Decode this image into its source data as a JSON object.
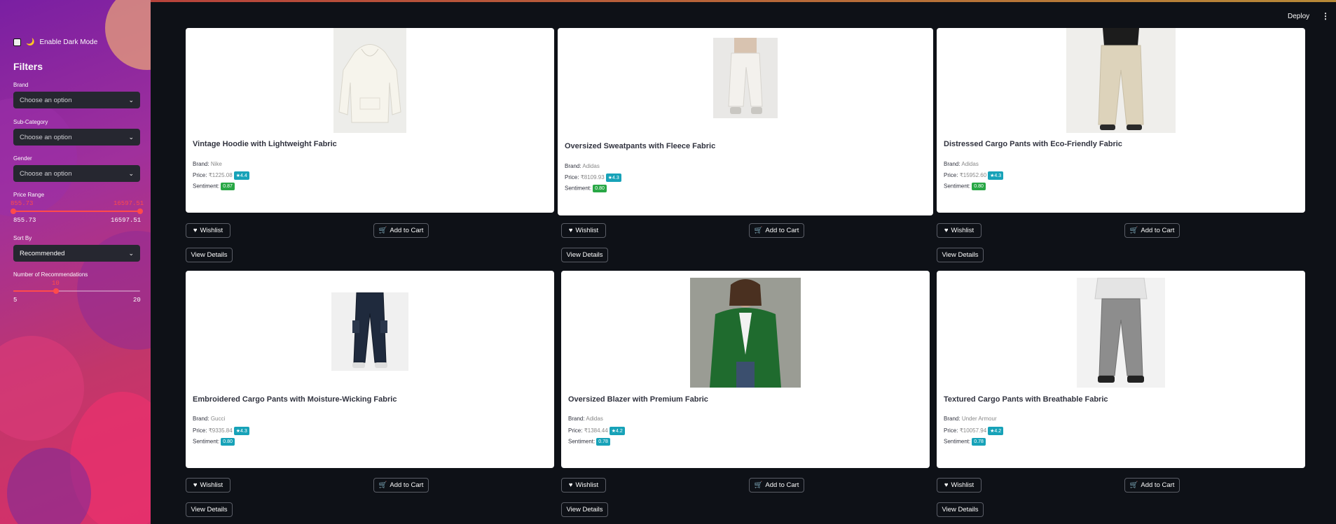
{
  "header": {
    "deploy_label": "Deploy",
    "menu_icon": "⋮"
  },
  "sidebar": {
    "dark_mode_label": "Enable Dark Mode",
    "dark_mode_checked": false,
    "dark_mode_icon": "🌙",
    "filters_title": "Filters",
    "brand": {
      "label": "Brand",
      "value": "Choose an option"
    },
    "subcategory": {
      "label": "Sub-Category",
      "value": "Choose an option"
    },
    "gender": {
      "label": "Gender",
      "value": "Choose an option"
    },
    "price_range": {
      "label": "Price Range",
      "low": "855.73",
      "high": "16597.51",
      "min": "855.73",
      "max": "16597.51"
    },
    "sort_by": {
      "label": "Sort By",
      "value": "Recommended"
    },
    "num_recs": {
      "label": "Number of Recommendations",
      "value": "10",
      "min": "5",
      "max": "20"
    }
  },
  "products": [
    {
      "title": "Vintage Hoodie with Lightweight Fabric",
      "brand_label": "Brand:",
      "brand": "Nike",
      "price_label": "Price:",
      "price": "₹1225.08",
      "rating": "★4.4",
      "sentiment_label": "Sentiment:",
      "sentiment": "0.87",
      "sentiment_color": "#28a745",
      "image": "hoodie"
    },
    {
      "title": "Oversized Sweatpants with Fleece Fabric",
      "brand_label": "Brand:",
      "brand": "Adidas",
      "price_label": "Price:",
      "price": "₹8109.93",
      "rating": "★4.3",
      "sentiment_label": "Sentiment:",
      "sentiment": "0.80",
      "sentiment_color": "#28a745",
      "image": "sweatpants"
    },
    {
      "title": "Distressed Cargo Pants with Eco-Friendly Fabric",
      "brand_label": "Brand:",
      "brand": "Adidas",
      "price_label": "Price:",
      "price": "₹15952.60",
      "rating": "★4.3",
      "sentiment_label": "Sentiment:",
      "sentiment": "0.80",
      "sentiment_color": "#28a745",
      "image": "cargo-beige"
    },
    {
      "title": "Embroidered Cargo Pants with Moisture-Wicking Fabric",
      "brand_label": "Brand:",
      "brand": "Gucci",
      "price_label": "Price:",
      "price": "₹9335.84",
      "rating": "★4.3",
      "sentiment_label": "Sentiment:",
      "sentiment": "0.80",
      "sentiment_color": "#17a2b8",
      "image": "cargo-navy"
    },
    {
      "title": "Oversized Blazer with Premium Fabric",
      "brand_label": "Brand:",
      "brand": "Adidas",
      "price_label": "Price:",
      "price": "₹1384.44",
      "rating": "★4.2",
      "sentiment_label": "Sentiment:",
      "sentiment": "0.78",
      "sentiment_color": "#17a2b8",
      "image": "blazer"
    },
    {
      "title": "Textured Cargo Pants with Breathable Fabric",
      "brand_label": "Brand:",
      "brand": "Under Armour",
      "price_label": "Price:",
      "price": "₹10057.94",
      "rating": "★4.2",
      "sentiment_label": "Sentiment:",
      "sentiment": "0.78",
      "sentiment_color": "#17a2b8",
      "image": "pants-grey"
    }
  ],
  "buttons": {
    "wishlist": "Wishlist",
    "add_to_cart": "Add to Cart",
    "view_details": "View Details",
    "heart_icon": "♥",
    "cart_icon": "🛒"
  },
  "colors": {
    "rating_badge": "#17a2b8",
    "accent": "#ff4b4b",
    "background": "#0e1117"
  }
}
